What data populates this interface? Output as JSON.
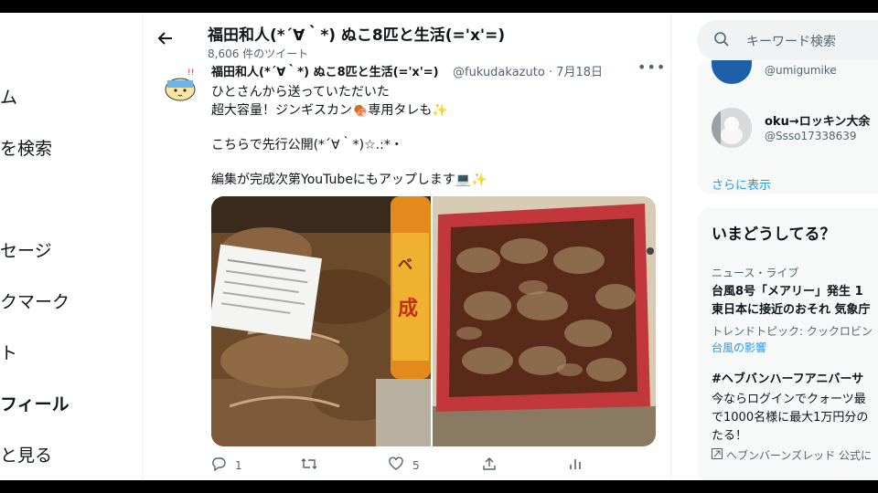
{
  "nav": {
    "items": [
      {
        "label": "ム",
        "bold": false
      },
      {
        "label": "を検索",
        "bold": false
      },
      {
        "label": "セージ",
        "bold": false
      },
      {
        "label": "クマーク",
        "bold": false
      },
      {
        "label": "ト",
        "bold": false
      },
      {
        "label": "フィール",
        "bold": true
      },
      {
        "label": "と見る",
        "bold": false
      }
    ]
  },
  "header": {
    "back_icon": "back-arrow-icon",
    "title": "福田和人(*´∀｀*) ぬこ8匹と生活(='x'=)",
    "tweet_count": "8,606 件のツイート"
  },
  "tweet": {
    "name": "福田和人(*´∀｀*) ぬこ8匹と生活(='x'=)",
    "handle_date": "@fukudakazuto · 7月18日",
    "lines": [
      "ひとさんから送っていただいた",
      "超大容量！ジンギスカン🍖専用タレも✨",
      "",
      "こちらで先行公開(*´∀｀*)☆.:*・",
      "",
      "編集が完成次第YouTubeにもアップします💻✨"
    ],
    "actions": {
      "reply": "1",
      "retweet": "",
      "like": "5"
    }
  },
  "right": {
    "search_placeholder": "キーワード検索",
    "follow": {
      "partial_handle": "@umigumike",
      "user_name": "oku→ロッキン大余",
      "user_handle": "@Ssso17338639",
      "more_link": "さらに表示"
    },
    "trends": {
      "title": "いまどうしてる？",
      "items": [
        {
          "context": "ニュース・ライブ",
          "headline": "台風8号「メアリー」発生 1",
          "headline2": "東日本に接近のおそれ 気象庁"
        },
        {
          "context": "トレンドトピック: クックロビン",
          "headline": "台風の影響",
          "link": true
        },
        {
          "context": "",
          "headline": "#ヘブバンハーフアニバーサ",
          "sub1": "今ならログインでクォーツ最",
          "sub2": "で1000名様に最大1万円分の",
          "sub3": "たる！",
          "promo": "ヘブンバーンズレッド 公式に"
        }
      ]
    }
  },
  "colors": {
    "accent": "#1d9bf0",
    "muted": "#536471",
    "text": "#0f1419"
  }
}
